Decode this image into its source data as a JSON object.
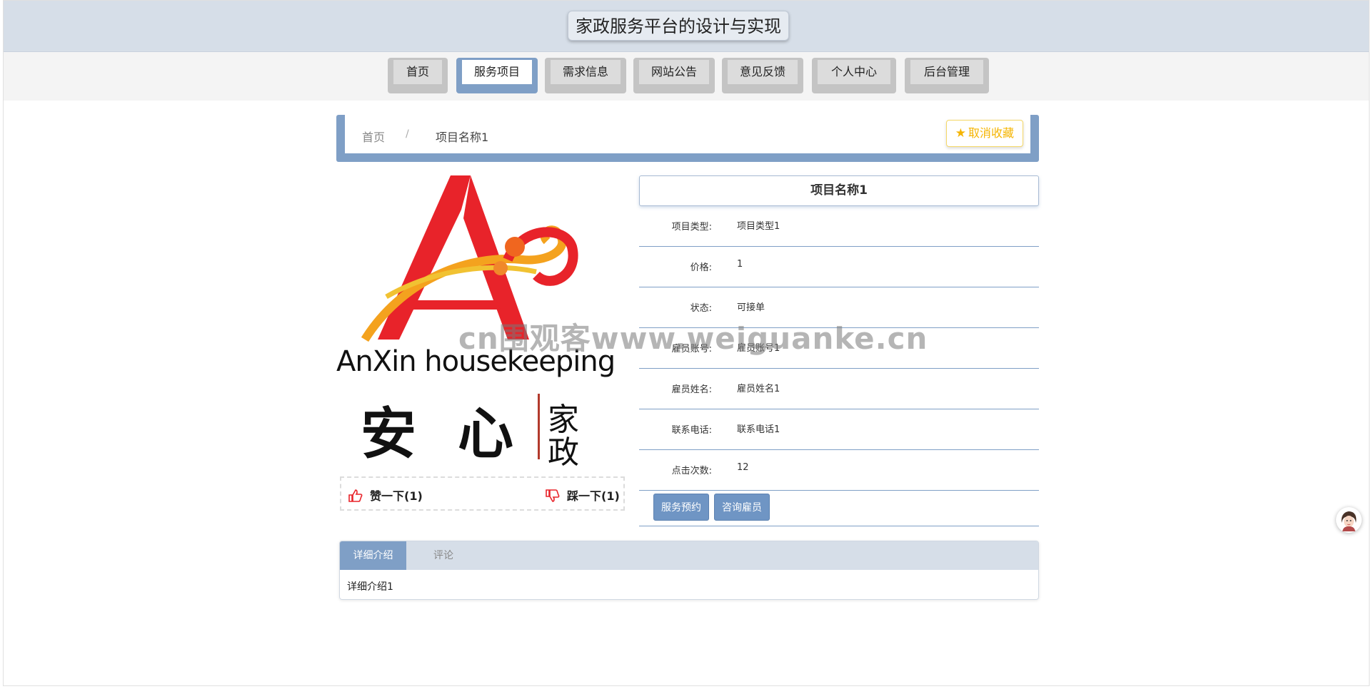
{
  "header": {
    "title": "家政服务平台的设计与实现"
  },
  "nav": {
    "items": [
      {
        "label": "首页"
      },
      {
        "label": "服务项目"
      },
      {
        "label": "需求信息"
      },
      {
        "label": "网站公告"
      },
      {
        "label": "意见反馈"
      },
      {
        "label": "个人中心"
      },
      {
        "label": "后台管理"
      }
    ],
    "active": "服务项目"
  },
  "breadcrumb": {
    "home": "首页",
    "separator": "/",
    "current": "项目名称1"
  },
  "favorite": {
    "label": "取消收藏",
    "icon": "star-icon",
    "color": "#f5b400"
  },
  "logo": {
    "brand_en": "AnXin housekeeping",
    "char1": "安",
    "char2": "心",
    "char3": "家",
    "char4": "政"
  },
  "like": {
    "like_label": "赞一下(1)",
    "dislike_label": "踩一下(1)"
  },
  "detail": {
    "title": "项目名称1",
    "rows": [
      {
        "label": "项目类型:",
        "value": "项目类型1"
      },
      {
        "label": "价格:",
        "value": "1"
      },
      {
        "label": "状态:",
        "value": "可接单"
      },
      {
        "label": "雇员账号:",
        "value": "雇员账号1"
      },
      {
        "label": "雇员姓名:",
        "value": "雇员姓名1"
      },
      {
        "label": "联系电话:",
        "value": "联系电话1"
      },
      {
        "label": "点击次数:",
        "value": "12"
      }
    ],
    "buttons": {
      "book": "服务预约",
      "consult": "咨询雇员"
    }
  },
  "tabs": {
    "items": [
      {
        "label": "详细介绍"
      },
      {
        "label": "评论"
      }
    ],
    "content": "详细介绍1"
  },
  "watermark": "cn围观客www.weiguanke.cn",
  "colors": {
    "accent": "#7f9fc6",
    "header_bg": "#d6dee8",
    "button": "#6f95c4"
  }
}
